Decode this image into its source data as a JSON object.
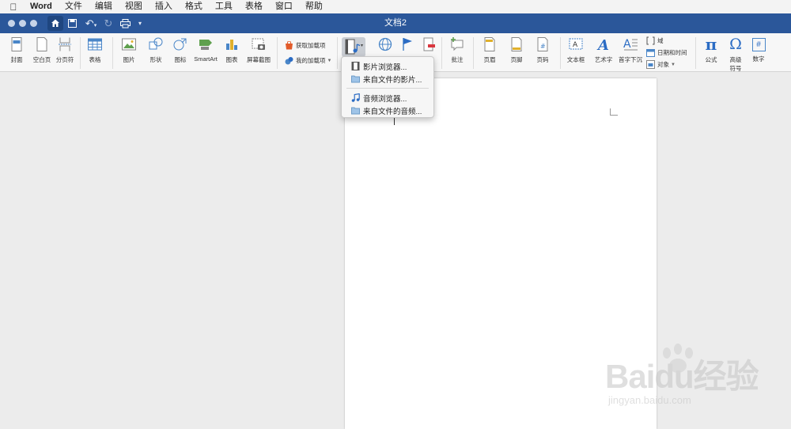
{
  "menubar": {
    "app": "Word",
    "items": [
      "文件",
      "编辑",
      "视图",
      "插入",
      "格式",
      "工具",
      "表格",
      "窗口",
      "帮助"
    ]
  },
  "window": {
    "title": "文档2"
  },
  "ribbon": {
    "cover": "封面",
    "blank_page": "空白页",
    "page_break": "分页符",
    "table": "表格",
    "picture": "图片",
    "shapes": "形状",
    "icons": "图标",
    "smartart": "SmartArt",
    "chart": "图表",
    "screenshot": "屏幕截图",
    "get_addins": "获取加载项",
    "my_addins": "我的加载项",
    "comment": "批注",
    "header": "页眉",
    "footer": "页脚",
    "page_number": "页码",
    "textbox": "文本框",
    "wordart": "艺术字",
    "dropcap": "首字下沉",
    "field": "域",
    "date_time": "日期和时间",
    "object": "对象",
    "equation": "公式",
    "symbol_line1": "高级",
    "symbol_line2": "符号",
    "number": "数字",
    "equation_glyph": "π",
    "symbol_glyph": "Ω",
    "number_glyph": "#"
  },
  "dropdown": {
    "items": [
      "影片浏览器...",
      "来自文件的影片...",
      "音频浏览器...",
      "来自文件的音频..."
    ]
  },
  "watermark": {
    "logo": "Baidu经验",
    "site": "jingyan.baidu.com"
  },
  "colors": {
    "titlebar": "#2b579a",
    "accent_blue": "#2b6cc4",
    "ribbon_bg": "#f7f7f7"
  }
}
